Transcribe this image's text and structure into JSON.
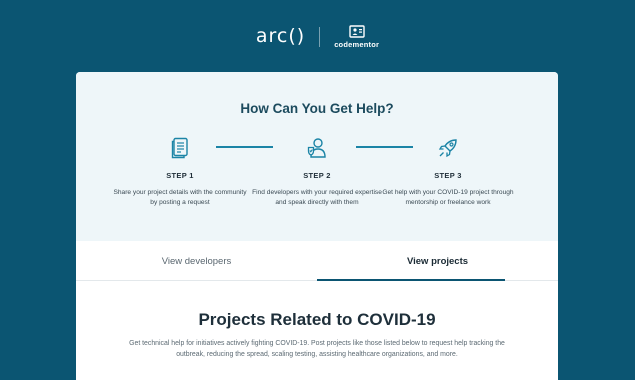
{
  "brand": {
    "arc_logo": "arc()",
    "partner_logo": "codementor"
  },
  "help": {
    "title": "How Can You Get Help?",
    "steps": [
      {
        "label": "STEP 1",
        "description": "Share your project details with the community by posting a request",
        "icon": "document-icon"
      },
      {
        "label": "STEP 2",
        "description": "Find developers with your required expertise and speak directly with them",
        "icon": "developer-icon"
      },
      {
        "label": "STEP 3",
        "description": "Get help with your COVID-19 project through mentorship or freelance work",
        "icon": "rocket-icon"
      }
    ]
  },
  "tabs": [
    {
      "label": "View developers",
      "active": false
    },
    {
      "label": "View projects",
      "active": true
    }
  ],
  "projects": {
    "title": "Projects Related to COVID-19",
    "description": "Get technical help for initiatives actively fighting COVID-19. Post projects like those listed below to request help tracking the outbreak, reducing the spread, scaling testing, assisting healthcare organizations, and more."
  },
  "colors": {
    "background": "#0b5572",
    "accent": "#1b84a6",
    "help_panel": "#eef6f9"
  }
}
